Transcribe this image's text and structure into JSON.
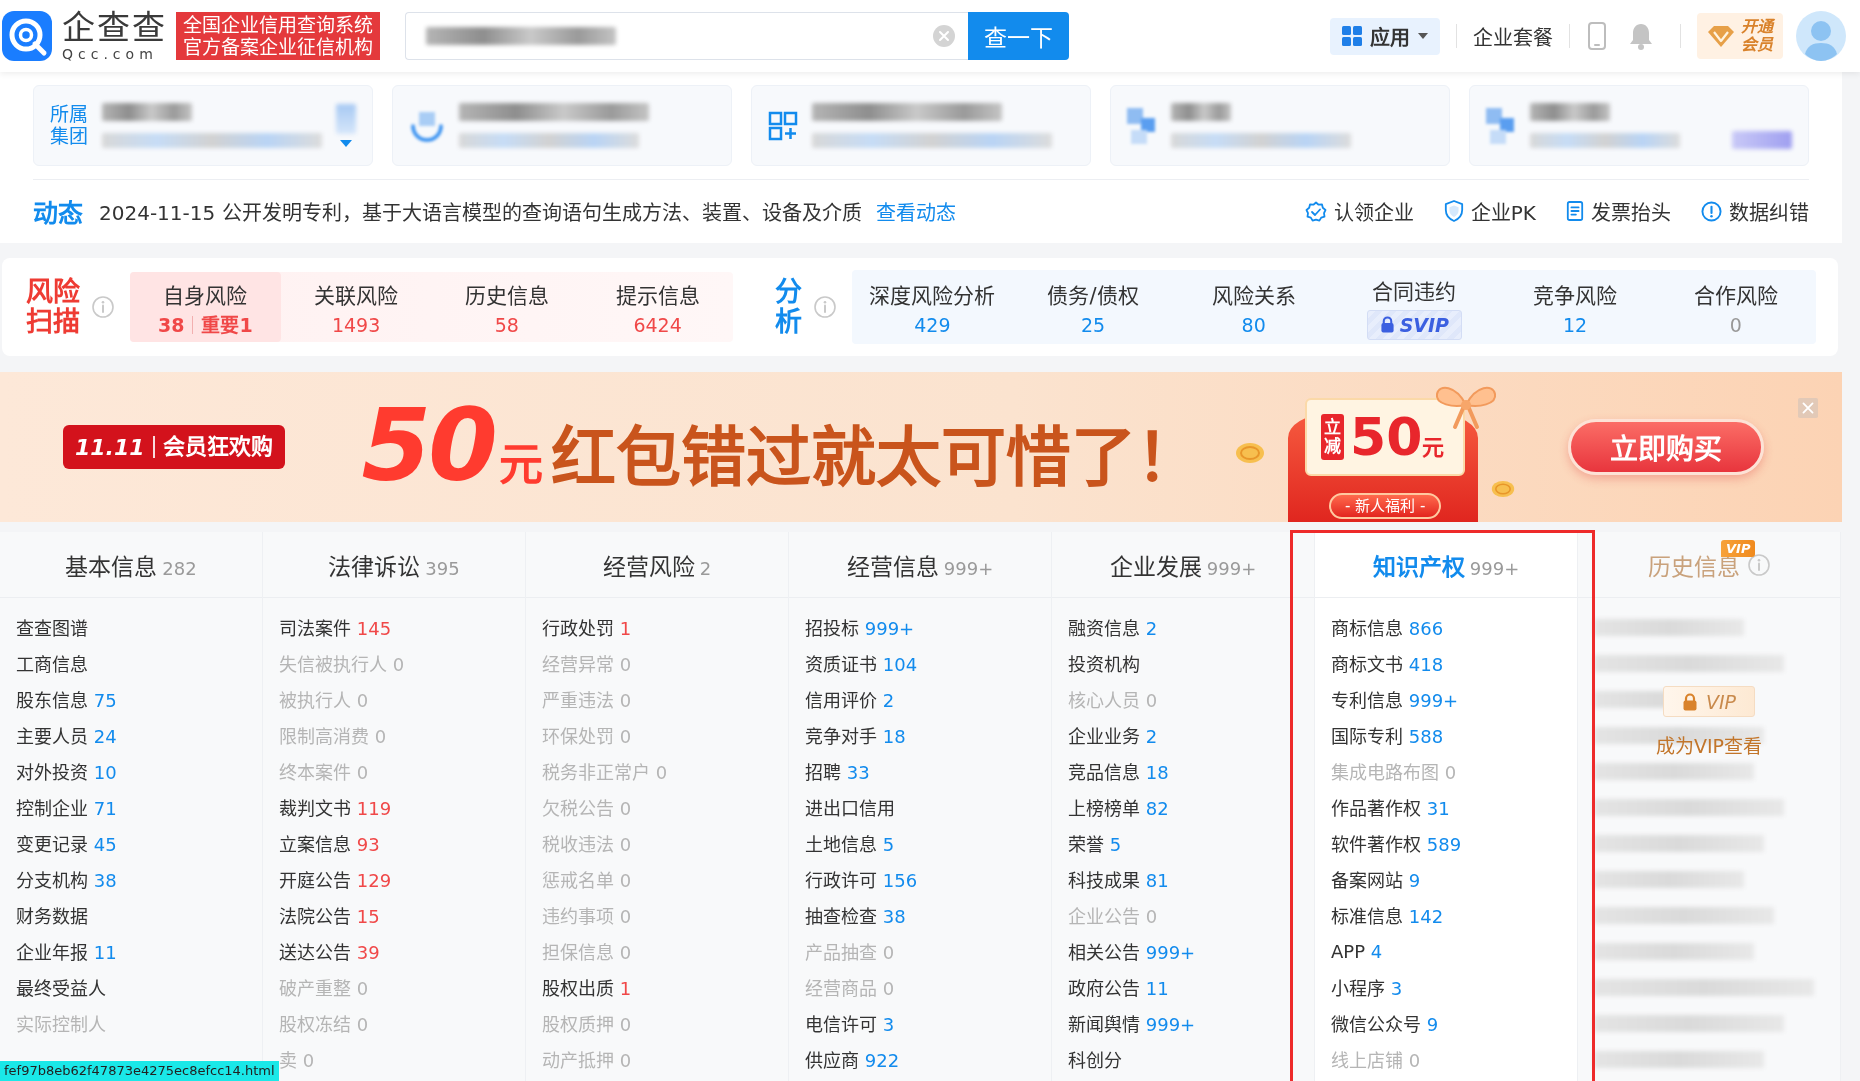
{
  "header": {
    "logo": {
      "name": "企查查",
      "domain": "Qcc.com"
    },
    "slogan": [
      "全国企业信用查询系统",
      "官方备案企业征信机构"
    ],
    "search_button": "查一下",
    "apps_menu": "应用",
    "plans_link": "企业套餐",
    "vip_button": "开通会员"
  },
  "related_cards": [
    {
      "kind": "group",
      "label": "所属集团"
    },
    {
      "kind": "ring"
    },
    {
      "kind": "grid"
    },
    {
      "kind": "logo"
    },
    {
      "kind": "logo_badge"
    }
  ],
  "news": {
    "title": "动态",
    "text": "2024-11-15 公开发明专利，基于大语言模型的查询语句生成方法、装置、设备及介质",
    "link": "查看动态"
  },
  "actions": [
    {
      "kind": "claim",
      "label": "认领企业"
    },
    {
      "kind": "pk",
      "label": "企业PK"
    },
    {
      "kind": "invoice",
      "label": "发票抬头"
    },
    {
      "kind": "report",
      "label": "数据纠错"
    }
  ],
  "risk_scan": {
    "title": "风险扫描",
    "items": [
      {
        "label": "自身风险",
        "value": "38",
        "note": "重要1",
        "selected": true
      },
      {
        "label": "关联风险",
        "value": "1493",
        "selected": false
      },
      {
        "label": "历史信息",
        "value": "58",
        "selected": false
      },
      {
        "label": "提示信息",
        "value": "6424",
        "selected": false
      }
    ]
  },
  "analysis": {
    "title": "分析",
    "items": [
      {
        "label": "深度风险分析",
        "kind": "count",
        "value": "429"
      },
      {
        "label": "债务/债权",
        "kind": "count",
        "value": "25"
      },
      {
        "label": "风险关系",
        "kind": "count",
        "value": "80"
      },
      {
        "label": "合同违约",
        "kind": "locked",
        "badge": "SVIP"
      },
      {
        "label": "竞争风险",
        "kind": "count",
        "value": "12"
      },
      {
        "label": "合作风险",
        "kind": "zero",
        "value": "0"
      }
    ]
  },
  "promo": {
    "tag": {
      "date": "11.11",
      "text": "会员狂欢购"
    },
    "amount": "50",
    "unit": "元",
    "headline": "红包错过就太可惜了！",
    "gift": {
      "tag": "立减",
      "amount": "50",
      "unit": "元",
      "ribbon": "- 新人福利 -"
    },
    "button": "立即购买"
  },
  "sections": [
    {
      "title": "基本信息",
      "count": "282",
      "kind": "list",
      "selected": false,
      "highlighted": false,
      "items": [
        {
          "label": "查查图谱",
          "kind": "normal"
        },
        {
          "label": "工商信息",
          "kind": "normal"
        },
        {
          "label": "股东信息",
          "count": "75",
          "kind": "normal"
        },
        {
          "label": "主要人员",
          "count": "24",
          "kind": "normal"
        },
        {
          "label": "对外投资",
          "count": "10",
          "kind": "normal"
        },
        {
          "label": "控制企业",
          "count": "71",
          "kind": "normal"
        },
        {
          "label": "变更记录",
          "count": "45",
          "kind": "normal"
        },
        {
          "label": "分支机构",
          "count": "38",
          "kind": "normal"
        },
        {
          "label": "财务数据",
          "kind": "normal"
        },
        {
          "label": "企业年报",
          "count": "11",
          "kind": "normal"
        },
        {
          "label": "最终受益人",
          "kind": "normal"
        },
        {
          "label": "实际控制人",
          "kind": "empty"
        }
      ]
    },
    {
      "title": "法律诉讼",
      "count": "395",
      "kind": "list",
      "selected": false,
      "highlighted": false,
      "items": [
        {
          "label": "司法案件",
          "count": "145",
          "kind": "alert"
        },
        {
          "label": "失信被执行人",
          "count": "0",
          "kind": "empty"
        },
        {
          "label": "被执行人",
          "count": "0",
          "kind": "empty"
        },
        {
          "label": "限制高消费",
          "count": "0",
          "kind": "empty"
        },
        {
          "label": "终本案件",
          "count": "0",
          "kind": "empty"
        },
        {
          "label": "裁判文书",
          "count": "119",
          "kind": "alert"
        },
        {
          "label": "立案信息",
          "count": "93",
          "kind": "alert"
        },
        {
          "label": "开庭公告",
          "count": "129",
          "kind": "alert"
        },
        {
          "label": "法院公告",
          "count": "15",
          "kind": "alert"
        },
        {
          "label": "送达公告",
          "count": "39",
          "kind": "alert"
        },
        {
          "label": "破产重整",
          "count": "0",
          "kind": "empty"
        },
        {
          "label": "股权冻结",
          "count": "0",
          "kind": "empty"
        },
        {
          "label": "卖",
          "count": "0",
          "kind": "empty"
        }
      ]
    },
    {
      "title": "经营风险",
      "count": "2",
      "kind": "list",
      "selected": false,
      "highlighted": false,
      "items": [
        {
          "label": "行政处罚",
          "count": "1",
          "kind": "alert"
        },
        {
          "label": "经营异常",
          "count": "0",
          "kind": "empty"
        },
        {
          "label": "严重违法",
          "count": "0",
          "kind": "empty"
        },
        {
          "label": "环保处罚",
          "count": "0",
          "kind": "empty"
        },
        {
          "label": "税务非正常户",
          "count": "0",
          "kind": "empty"
        },
        {
          "label": "欠税公告",
          "count": "0",
          "kind": "empty"
        },
        {
          "label": "税收违法",
          "count": "0",
          "kind": "empty"
        },
        {
          "label": "惩戒名单",
          "count": "0",
          "kind": "empty"
        },
        {
          "label": "违约事项",
          "count": "0",
          "kind": "empty"
        },
        {
          "label": "担保信息",
          "count": "0",
          "kind": "empty"
        },
        {
          "label": "股权出质",
          "count": "1",
          "kind": "alert"
        },
        {
          "label": "股权质押",
          "count": "0",
          "kind": "empty"
        },
        {
          "label": "动产抵押",
          "count": "0",
          "kind": "empty"
        }
      ]
    },
    {
      "title": "经营信息",
      "count": "999+",
      "kind": "list",
      "selected": false,
      "highlighted": false,
      "items": [
        {
          "label": "招投标",
          "count": "999+",
          "kind": "normal"
        },
        {
          "label": "资质证书",
          "count": "104",
          "kind": "normal"
        },
        {
          "label": "信用评价",
          "count": "2",
          "kind": "normal"
        },
        {
          "label": "竞争对手",
          "count": "18",
          "kind": "normal"
        },
        {
          "label": "招聘",
          "count": "33",
          "kind": "normal"
        },
        {
          "label": "进出口信用",
          "kind": "normal"
        },
        {
          "label": "土地信息",
          "count": "5",
          "kind": "normal"
        },
        {
          "label": "行政许可",
          "count": "156",
          "kind": "normal"
        },
        {
          "label": "抽查检查",
          "count": "38",
          "kind": "normal"
        },
        {
          "label": "产品抽查",
          "count": "0",
          "kind": "empty"
        },
        {
          "label": "经营商品",
          "count": "0",
          "kind": "empty"
        },
        {
          "label": "电信许可",
          "count": "3",
          "kind": "normal"
        },
        {
          "label": "供应商",
          "count": "922",
          "kind": "normal"
        }
      ]
    },
    {
      "title": "企业发展",
      "count": "999+",
      "kind": "list",
      "selected": false,
      "highlighted": false,
      "items": [
        {
          "label": "融资信息",
          "count": "2",
          "kind": "normal"
        },
        {
          "label": "投资机构",
          "kind": "normal"
        },
        {
          "label": "核心人员",
          "count": "0",
          "kind": "empty"
        },
        {
          "label": "企业业务",
          "count": "2",
          "kind": "normal"
        },
        {
          "label": "竞品信息",
          "count": "18",
          "kind": "normal"
        },
        {
          "label": "上榜榜单",
          "count": "82",
          "kind": "normal"
        },
        {
          "label": "荣誉",
          "count": "5",
          "kind": "normal"
        },
        {
          "label": "科技成果",
          "count": "81",
          "kind": "normal"
        },
        {
          "label": "企业公告",
          "count": "0",
          "kind": "empty"
        },
        {
          "label": "相关公告",
          "count": "999+",
          "kind": "normal"
        },
        {
          "label": "政府公告",
          "count": "11",
          "kind": "normal"
        },
        {
          "label": "新闻舆情",
          "count": "999+",
          "kind": "normal"
        },
        {
          "label": "科创分",
          "kind": "normal"
        }
      ]
    },
    {
      "title": "知识产权",
      "count": "999+",
      "kind": "list",
      "selected": true,
      "highlighted": true,
      "items": [
        {
          "label": "商标信息",
          "count": "866",
          "kind": "normal"
        },
        {
          "label": "商标文书",
          "count": "418",
          "kind": "normal"
        },
        {
          "label": "专利信息",
          "count": "999+",
          "kind": "normal"
        },
        {
          "label": "国际专利",
          "count": "588",
          "kind": "normal"
        },
        {
          "label": "集成电路布图",
          "count": "0",
          "kind": "empty"
        },
        {
          "label": "作品著作权",
          "count": "31",
          "kind": "normal"
        },
        {
          "label": "软件著作权",
          "count": "589",
          "kind": "normal"
        },
        {
          "label": "备案网站",
          "count": "9",
          "kind": "normal"
        },
        {
          "label": "标准信息",
          "count": "142",
          "kind": "normal"
        },
        {
          "label": "APP",
          "count": "4",
          "kind": "normal"
        },
        {
          "label": "小程序",
          "count": "3",
          "kind": "normal"
        },
        {
          "label": "微信公众号",
          "count": "9",
          "kind": "normal"
        },
        {
          "label": "线上店铺",
          "count": "0",
          "kind": "empty"
        }
      ]
    },
    {
      "title": "历史信息",
      "kind": "locked",
      "selected": false,
      "highlighted": false,
      "badge": "VIP",
      "lock_label": "VIP",
      "note": "成为VIP查看"
    }
  ],
  "status_url": "fef97b8eb62f47873e4275ec8efcc14.html"
}
